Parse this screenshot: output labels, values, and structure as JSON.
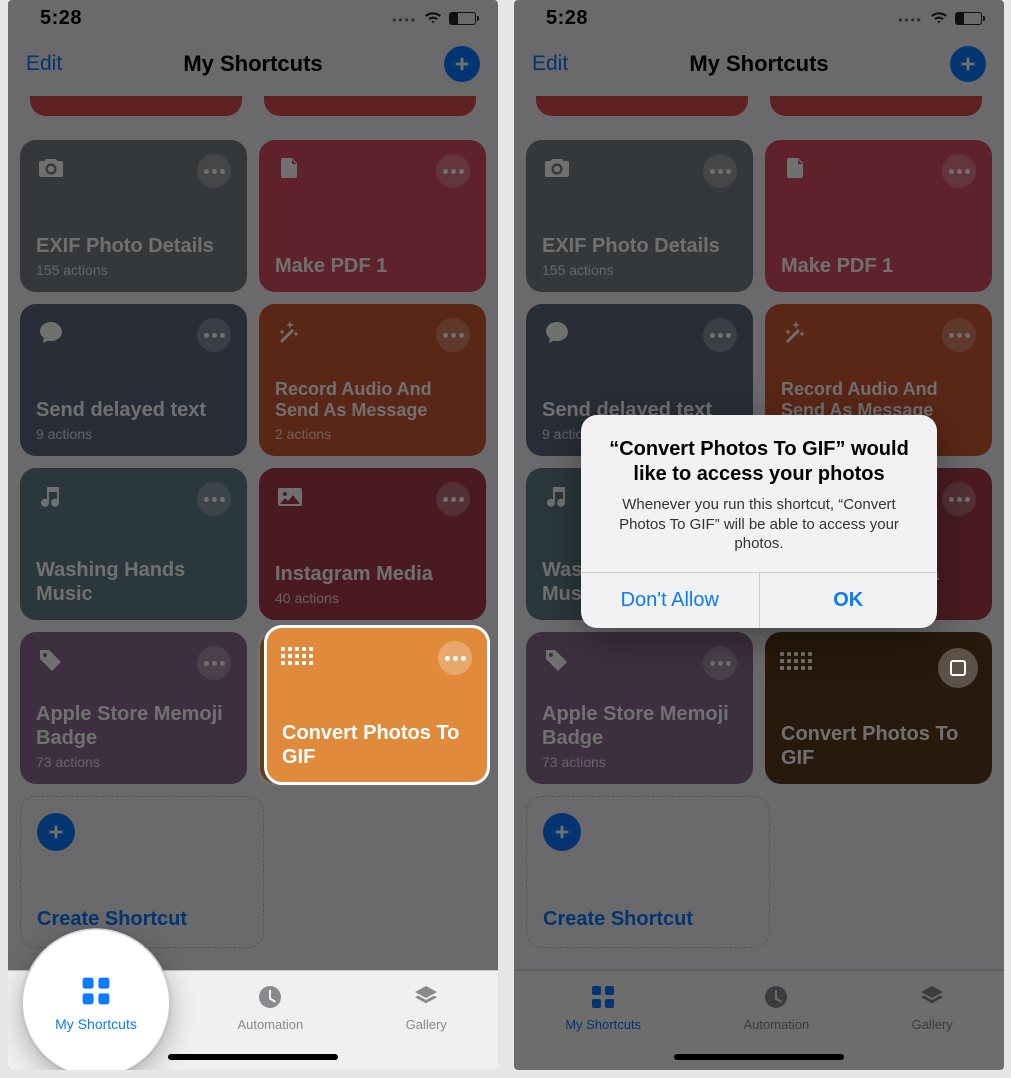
{
  "status": {
    "time": "5:28"
  },
  "nav": {
    "edit": "Edit",
    "title": "My Shortcuts"
  },
  "cards": [
    {
      "name": "EXIF Photo Details",
      "actions": "155 actions",
      "color": "c-gray",
      "icon": "camera"
    },
    {
      "name": "Make PDF 1",
      "actions": "",
      "color": "c-pink",
      "icon": "document"
    },
    {
      "name": "Send delayed text",
      "actions": "9 actions",
      "color": "c-slate",
      "icon": "chat"
    },
    {
      "name": "Record Audio And Send As Message",
      "actions": "2 actions",
      "color": "c-orange2",
      "icon": "wand"
    },
    {
      "name": "Washing Hands Music",
      "actions": "",
      "color": "c-teal",
      "icon": "music"
    },
    {
      "name": "Instagram Media",
      "actions": "40 actions",
      "color": "c-maroon",
      "icon": "image"
    },
    {
      "name": "Apple Store Memoji Badge",
      "actions": "73 actions",
      "color": "c-purple",
      "icon": "tag"
    },
    {
      "name": "Convert Photos To GIF",
      "actions": "",
      "color": "c-orange",
      "icon": "grid",
      "highlight": true
    }
  ],
  "create": "Create Shortcut",
  "tabs": {
    "shortcuts": "My Shortcuts",
    "automation": "Automation",
    "gallery": "Gallery"
  },
  "alert": {
    "title": "“Convert Photos To GIF” would like to access your photos",
    "message": "Whenever you run this shortcut, “Convert Photos To GIF” will be able to access your photos.",
    "deny": "Don't Allow",
    "allow": "OK"
  }
}
